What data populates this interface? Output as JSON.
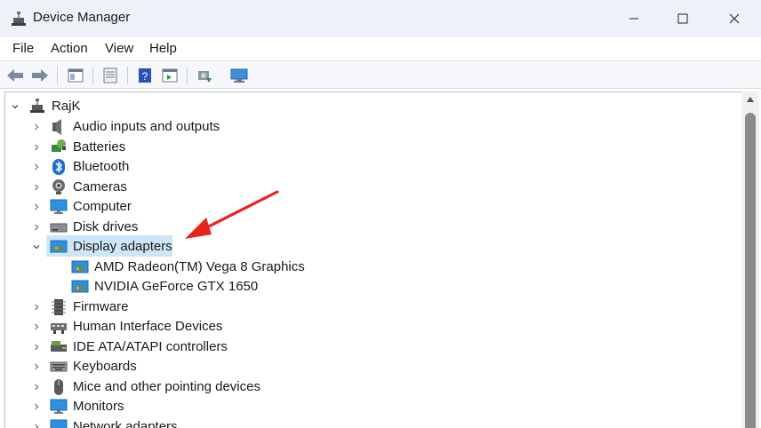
{
  "window": {
    "title": "Device Manager",
    "minimize_glyph": "—",
    "maximize_glyph": "☐",
    "close_glyph": "✕"
  },
  "menu": [
    "File",
    "Action",
    "View",
    "Help"
  ],
  "toolbar": {
    "buttons": [
      "back-icon",
      "forward-icon",
      "show-hide-tree-icon",
      "properties-icon",
      "help-icon",
      "action-pane-icon",
      "update-driver-icon",
      "scan-hardware-icon"
    ]
  },
  "tree": {
    "root": "RajK",
    "items": [
      {
        "label": "Audio inputs and outputs",
        "icon": "speaker-icon",
        "expanded": false
      },
      {
        "label": "Batteries",
        "icon": "battery-icon",
        "expanded": false
      },
      {
        "label": "Bluetooth",
        "icon": "bluetooth-icon",
        "expanded": false
      },
      {
        "label": "Cameras",
        "icon": "camera-icon",
        "expanded": false
      },
      {
        "label": "Computer",
        "icon": "computer-icon",
        "expanded": false
      },
      {
        "label": "Disk drives",
        "icon": "disk-drive-icon",
        "expanded": false
      },
      {
        "label": "Display adapters",
        "icon": "display-adapter-icon",
        "expanded": true,
        "selected": true,
        "children": [
          "AMD Radeon(TM) Vega 8 Graphics",
          "NVIDIA GeForce GTX 1650"
        ]
      },
      {
        "label": "Firmware",
        "icon": "firmware-icon",
        "expanded": false
      },
      {
        "label": "Human Interface Devices",
        "icon": "hid-icon",
        "expanded": false
      },
      {
        "label": "IDE ATA/ATAPI controllers",
        "icon": "ide-controller-icon",
        "expanded": false
      },
      {
        "label": "Keyboards",
        "icon": "keyboard-icon",
        "expanded": false
      },
      {
        "label": "Mice and other pointing devices",
        "icon": "mouse-icon",
        "expanded": false
      },
      {
        "label": "Monitors",
        "icon": "monitor-icon",
        "expanded": false
      },
      {
        "label": "Network adapters",
        "icon": "network-adapter-icon",
        "expanded": false
      }
    ]
  },
  "colors": {
    "selection": "#cde6f7",
    "annotation_arrow": "#e8231c",
    "titlebar": "#eef2f8"
  }
}
